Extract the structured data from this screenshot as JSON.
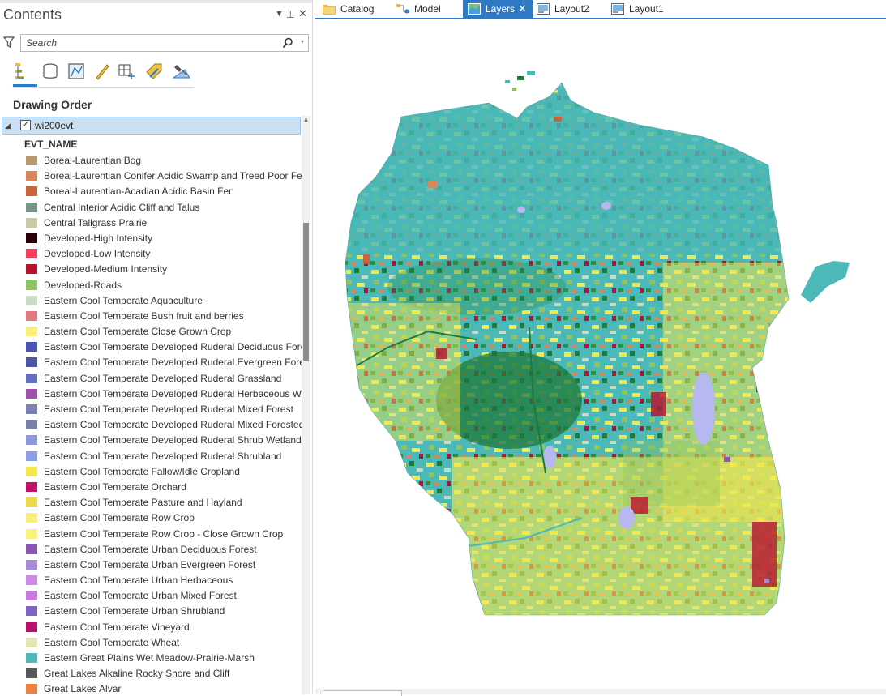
{
  "pane": {
    "title": "Contents",
    "pin_glyph": "▾ ⊥ ✕",
    "search_placeholder": "Search",
    "section_title": "Drawing Order",
    "layer": {
      "name": "wi200evt",
      "checked": true
    },
    "field_name": "EVT_NAME",
    "tools": [
      "list-by-drawing-order-icon",
      "list-by-source-icon",
      "list-by-selection-icon",
      "list-by-editing-icon",
      "list-by-snapping-icon",
      "list-by-labeling-icon",
      "list-by-perspective-imagery-icon"
    ]
  },
  "legend": [
    {
      "label": "Boreal-Laurentian Bog",
      "color": "#b99a70"
    },
    {
      "label": "Boreal-Laurentian Conifer Acidic Swamp and Treed Poor Fen",
      "color": "#d8865a"
    },
    {
      "label": "Boreal-Laurentian-Acadian Acidic Basin Fen",
      "color": "#c8643a"
    },
    {
      "label": "Central Interior Acidic Cliff and Talus",
      "color": "#7b9488"
    },
    {
      "label": "Central Tallgrass Prairie",
      "color": "#c9c9a3"
    },
    {
      "label": "Developed-High Intensity",
      "color": "#2b0006"
    },
    {
      "label": "Developed-Low Intensity",
      "color": "#f4405a"
    },
    {
      "label": "Developed-Medium Intensity",
      "color": "#b8102f"
    },
    {
      "label": "Developed-Roads",
      "color": "#8dc460"
    },
    {
      "label": "Eastern Cool Temperate Aquaculture",
      "color": "#c9dcc1"
    },
    {
      "label": "Eastern Cool Temperate Bush fruit and berries",
      "color": "#e07a80"
    },
    {
      "label": "Eastern Cool Temperate Close Grown Crop",
      "color": "#f8f07a"
    },
    {
      "label": "Eastern Cool Temperate Developed Ruderal Deciduous Fore",
      "color": "#4b55b9"
    },
    {
      "label": "Eastern Cool Temperate Developed Ruderal Evergreen Fores",
      "color": "#4a55a5"
    },
    {
      "label": "Eastern Cool Temperate Developed Ruderal Grassland",
      "color": "#6270c3"
    },
    {
      "label": "Eastern Cool Temperate Developed Ruderal Herbaceous We",
      "color": "#a04fb0"
    },
    {
      "label": "Eastern Cool Temperate Developed Ruderal Mixed Forest",
      "color": "#7b83b5"
    },
    {
      "label": "Eastern Cool Temperate Developed Ruderal Mixed Forested",
      "color": "#7682aa"
    },
    {
      "label": "Eastern Cool Temperate Developed Ruderal Shrub Wetland",
      "color": "#8b98e0"
    },
    {
      "label": "Eastern Cool Temperate Developed Ruderal Shrubland",
      "color": "#8aa0e6"
    },
    {
      "label": "Eastern Cool Temperate Fallow/Idle Cropland",
      "color": "#f2e84e"
    },
    {
      "label": "Eastern Cool Temperate Orchard",
      "color": "#c0106a"
    },
    {
      "label": "Eastern Cool Temperate Pasture and Hayland",
      "color": "#eed84c"
    },
    {
      "label": "Eastern Cool Temperate Row Crop",
      "color": "#f8f07a"
    },
    {
      "label": "Eastern Cool Temperate Row Crop - Close Grown Crop",
      "color": "#fbf27c"
    },
    {
      "label": "Eastern Cool Temperate Urban Deciduous Forest",
      "color": "#8c54b4"
    },
    {
      "label": "Eastern Cool Temperate Urban Evergreen Forest",
      "color": "#a98ad6"
    },
    {
      "label": "Eastern Cool Temperate Urban Herbaceous",
      "color": "#d08ae6"
    },
    {
      "label": "Eastern Cool Temperate Urban Mixed Forest",
      "color": "#c77be0"
    },
    {
      "label": "Eastern Cool Temperate Urban Shrubland",
      "color": "#7f63c2"
    },
    {
      "label": "Eastern Cool Temperate Vineyard",
      "color": "#b8106e"
    },
    {
      "label": "Eastern Cool Temperate Wheat",
      "color": "#e4e6b4"
    },
    {
      "label": "Eastern Great Plains Wet Meadow-Prairie-Marsh",
      "color": "#4cb8b8"
    },
    {
      "label": "Great Lakes Alkaline Rocky Shore and Cliff",
      "color": "#585858"
    },
    {
      "label": "Great Lakes Alvar",
      "color": "#f08040"
    }
  ],
  "tabs": [
    {
      "label": "Catalog",
      "icon": "catalog-icon",
      "active": false
    },
    {
      "label": "Model",
      "icon": "model-icon",
      "active": false
    },
    {
      "label": "Layers",
      "icon": "map-icon",
      "active": true
    },
    {
      "label": "Layout2",
      "icon": "layout-icon",
      "active": false
    },
    {
      "label": "Layout1",
      "icon": "layout-icon",
      "active": false
    }
  ],
  "map": {
    "subject": "Wisconsin existing vegetation type raster",
    "palette": {
      "teal": "#4cb8b8",
      "yellow": "#f2e84e",
      "green": "#1f7a3a",
      "forest": "#2a8f4a",
      "pale": "#c9dcc1",
      "lake": "#b8b8f0",
      "red": "#b8102f",
      "lime": "#8dc460",
      "orange": "#d8865a",
      "purple": "#8c54b4"
    }
  }
}
